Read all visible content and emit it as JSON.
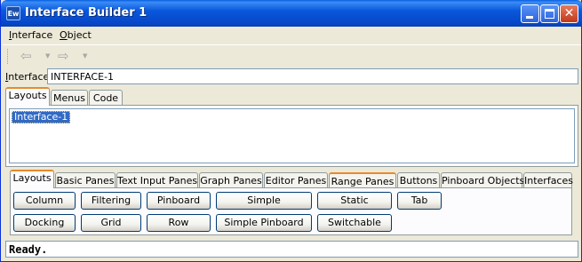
{
  "window": {
    "title": "Interface Builder 1",
    "icon_text": "Ew",
    "controls": {
      "minimize": "minimize",
      "maximize": "maximize",
      "close": "✕"
    }
  },
  "menubar": {
    "items": [
      {
        "label": "Interface",
        "mnemonic": "I"
      },
      {
        "label": "Object",
        "mnemonic": "O"
      }
    ]
  },
  "toolbar": {
    "back_icon": "⇦",
    "forward_icon": "⇨",
    "dropdown_icon": "▼"
  },
  "interface_field": {
    "label": "Interface:",
    "value": "INTERFACE-1"
  },
  "top_tabs": [
    {
      "label": "Layouts",
      "active": true
    },
    {
      "label": "Menus",
      "active": false
    },
    {
      "label": "Code",
      "active": false
    }
  ],
  "layouts_list": {
    "items": [
      "Interface-1"
    ],
    "selected": "Interface-1"
  },
  "palette_tabs": [
    {
      "label": "Layouts",
      "active": true
    },
    {
      "label": "Basic Panes",
      "active": false
    },
    {
      "label": "Text Input Panes",
      "active": false
    },
    {
      "label": "Graph Panes",
      "active": false
    },
    {
      "label": "Editor Panes",
      "active": false
    },
    {
      "label": "Range Panes",
      "active": false
    },
    {
      "label": "Buttons",
      "active": false
    },
    {
      "label": "Pinboard Objects",
      "active": false
    },
    {
      "label": "Interfaces",
      "active": false
    }
  ],
  "palette_buttons": {
    "row1": [
      "Column",
      "Filtering",
      "Pinboard",
      "Simple",
      "Static",
      "Tab"
    ],
    "row2": [
      "Docking",
      "Grid",
      "Row",
      "Simple Pinboard",
      "Switchable"
    ]
  },
  "status": {
    "text": "Ready."
  },
  "colors": {
    "title_bar": "#0a58dc",
    "selection": "#316ac5",
    "active_tab_accent": "#e68b2c",
    "button_border": "#003c74"
  }
}
